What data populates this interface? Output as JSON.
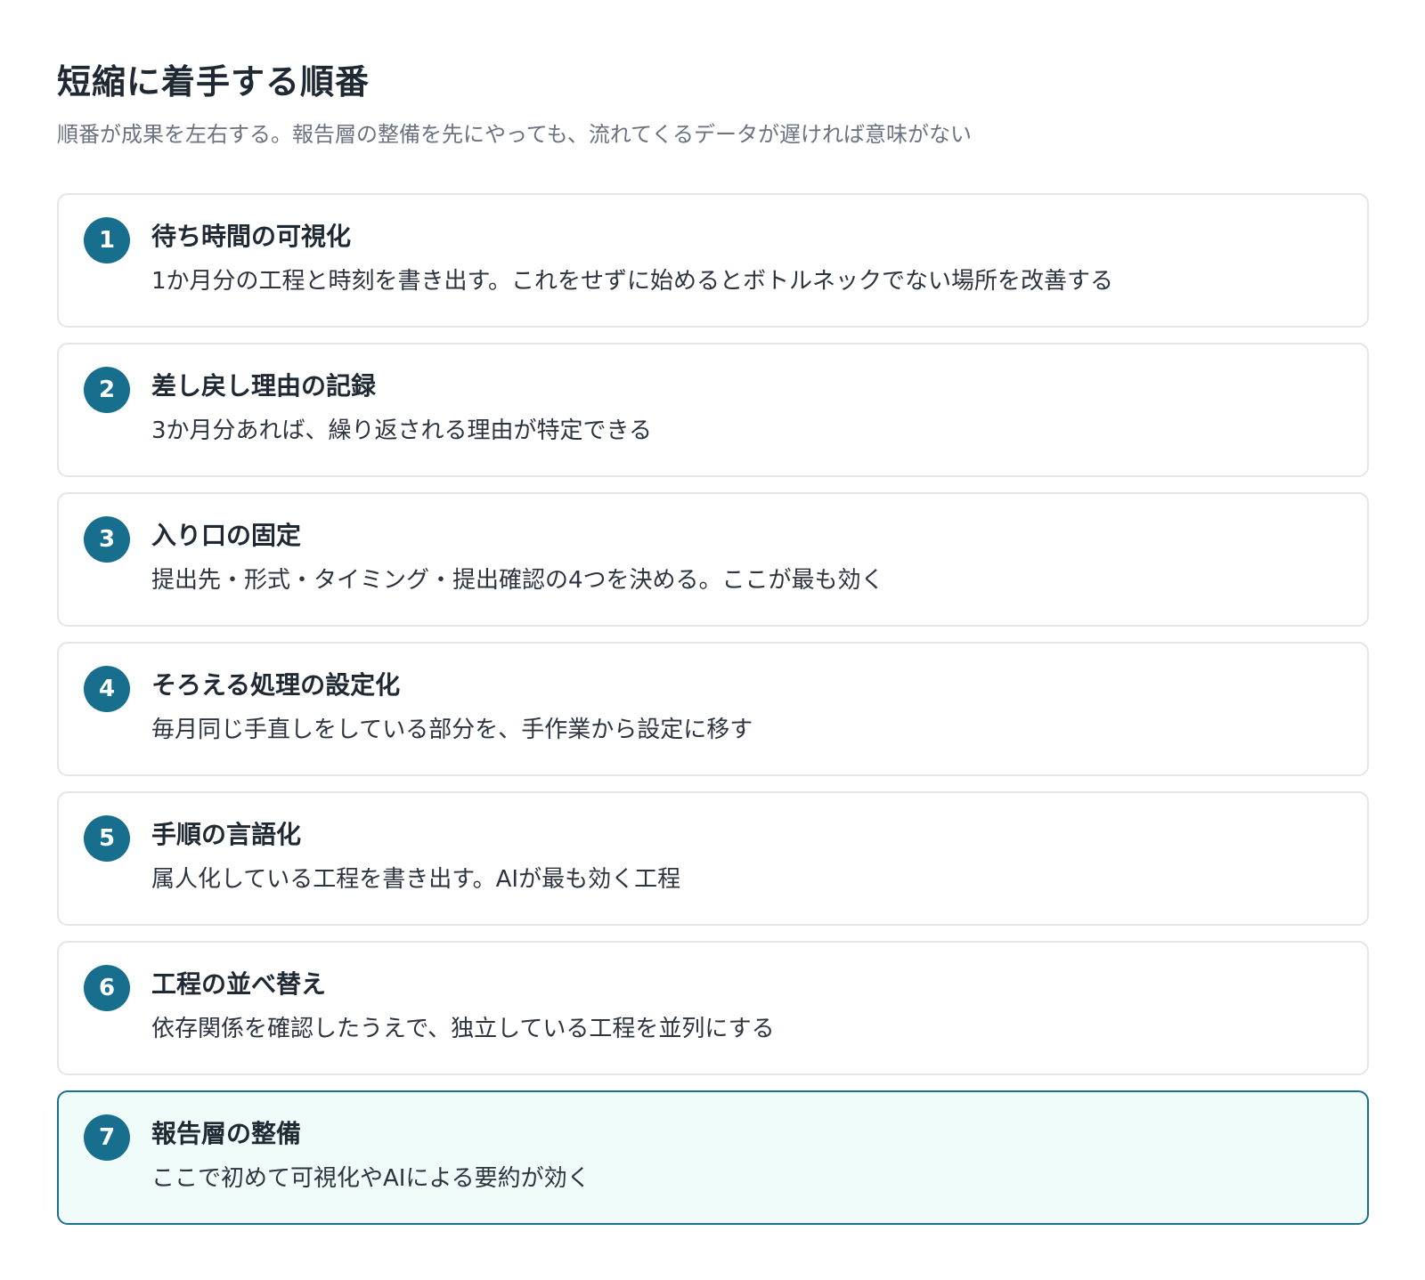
{
  "header": {
    "title": "短縮に着手する順番",
    "subtitle": "順番が成果を左右する。報告層の整備を先にやっても、流れてくるデータが遅ければ意味がない"
  },
  "colors": {
    "accent": "#176f8d",
    "highlight_background": "#effcf9",
    "highlight_border": "#1d6f8d"
  },
  "steps": [
    {
      "number": "1",
      "title": "待ち時間の可視化",
      "description": "1か月分の工程と時刻を書き出す。これをせずに始めるとボトルネックでない場所を改善する"
    },
    {
      "number": "2",
      "title": "差し戻し理由の記録",
      "description": "3か月分あれば、繰り返される理由が特定できる"
    },
    {
      "number": "3",
      "title": "入り口の固定",
      "description": "提出先・形式・タイミング・提出確認の4つを決める。ここが最も効く"
    },
    {
      "number": "4",
      "title": "そろえる処理の設定化",
      "description": "毎月同じ手直しをしている部分を、手作業から設定に移す"
    },
    {
      "number": "5",
      "title": "手順の言語化",
      "description": "属人化している工程を書き出す。AIが最も効く工程"
    },
    {
      "number": "6",
      "title": "工程の並べ替え",
      "description": "依存関係を確認したうえで、独立している工程を並列にする"
    },
    {
      "number": "7",
      "title": "報告層の整備",
      "description": "ここで初めて可視化やAIによる要約が効く"
    }
  ]
}
